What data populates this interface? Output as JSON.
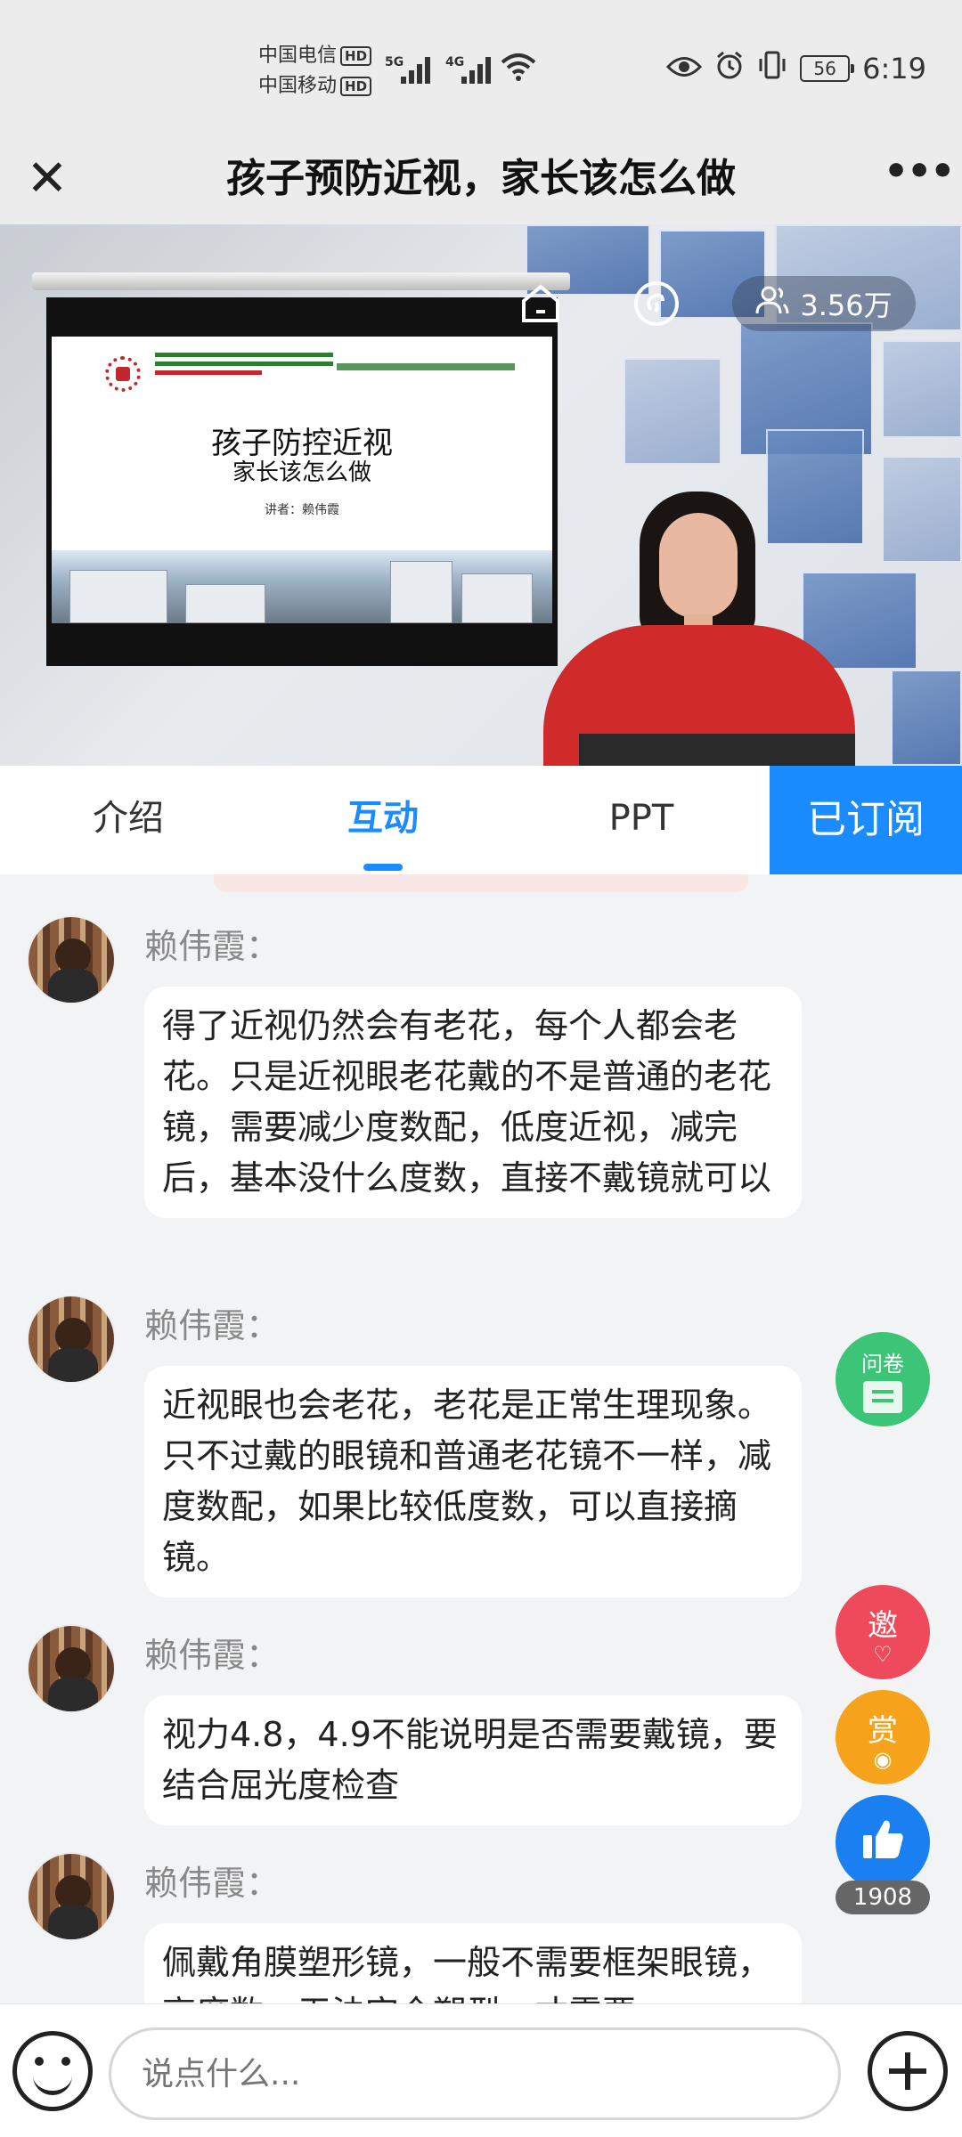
{
  "status_bar": {
    "carrier1": "中国电信",
    "carrier2": "中国移动",
    "hd": "HD",
    "net1": "5G",
    "net2": "4G",
    "battery": "56",
    "time": "6:19"
  },
  "header": {
    "title": "孩子预防近视，家长该怎么做"
  },
  "video": {
    "viewers": "3.56万",
    "slide": {
      "title": "孩子防控近视",
      "subtitle": "家长该怎么做",
      "author": "讲者：赖伟霞"
    }
  },
  "tabs": [
    {
      "label": "介绍"
    },
    {
      "label": "互动"
    },
    {
      "label": "PPT"
    }
  ],
  "subscribe_label": "已订阅",
  "messages": [
    {
      "sender": "赖伟霞：",
      "text": "得了近视仍然会有老花，每个人都会老花。只是近视眼老花戴的不是普通的老花镜，需要减少度数配，低度近视，减完后，基本没什么度数，直接不戴镜就可以"
    },
    {
      "sender": "赖伟霞：",
      "text": "近视眼也会老花，老花是正常生理现象。只不过戴的眼镜和普通老花镜不一样，减度数配，如果比较低度数，可以直接摘镜。"
    },
    {
      "sender": "赖伟霞：",
      "text": "视力4.8，4.9不能说明是否需要戴镜，要结合屈光度检查"
    },
    {
      "sender": "赖伟霞：",
      "text": "佩戴角膜塑形镜，一般不需要框架眼镜，高度数，无法完全塑型，才需要"
    }
  ],
  "side_buttons": {
    "questionnaire": "问卷",
    "invite": "邀",
    "reward": "赏",
    "like_count": "1908"
  },
  "input": {
    "placeholder": "说点什么..."
  },
  "colors": {
    "accent": "#1a8cff",
    "questionnaire": "#3cc477",
    "invite": "#ef4a5b",
    "reward": "#f7a21b",
    "like": "#1a7ff0"
  }
}
